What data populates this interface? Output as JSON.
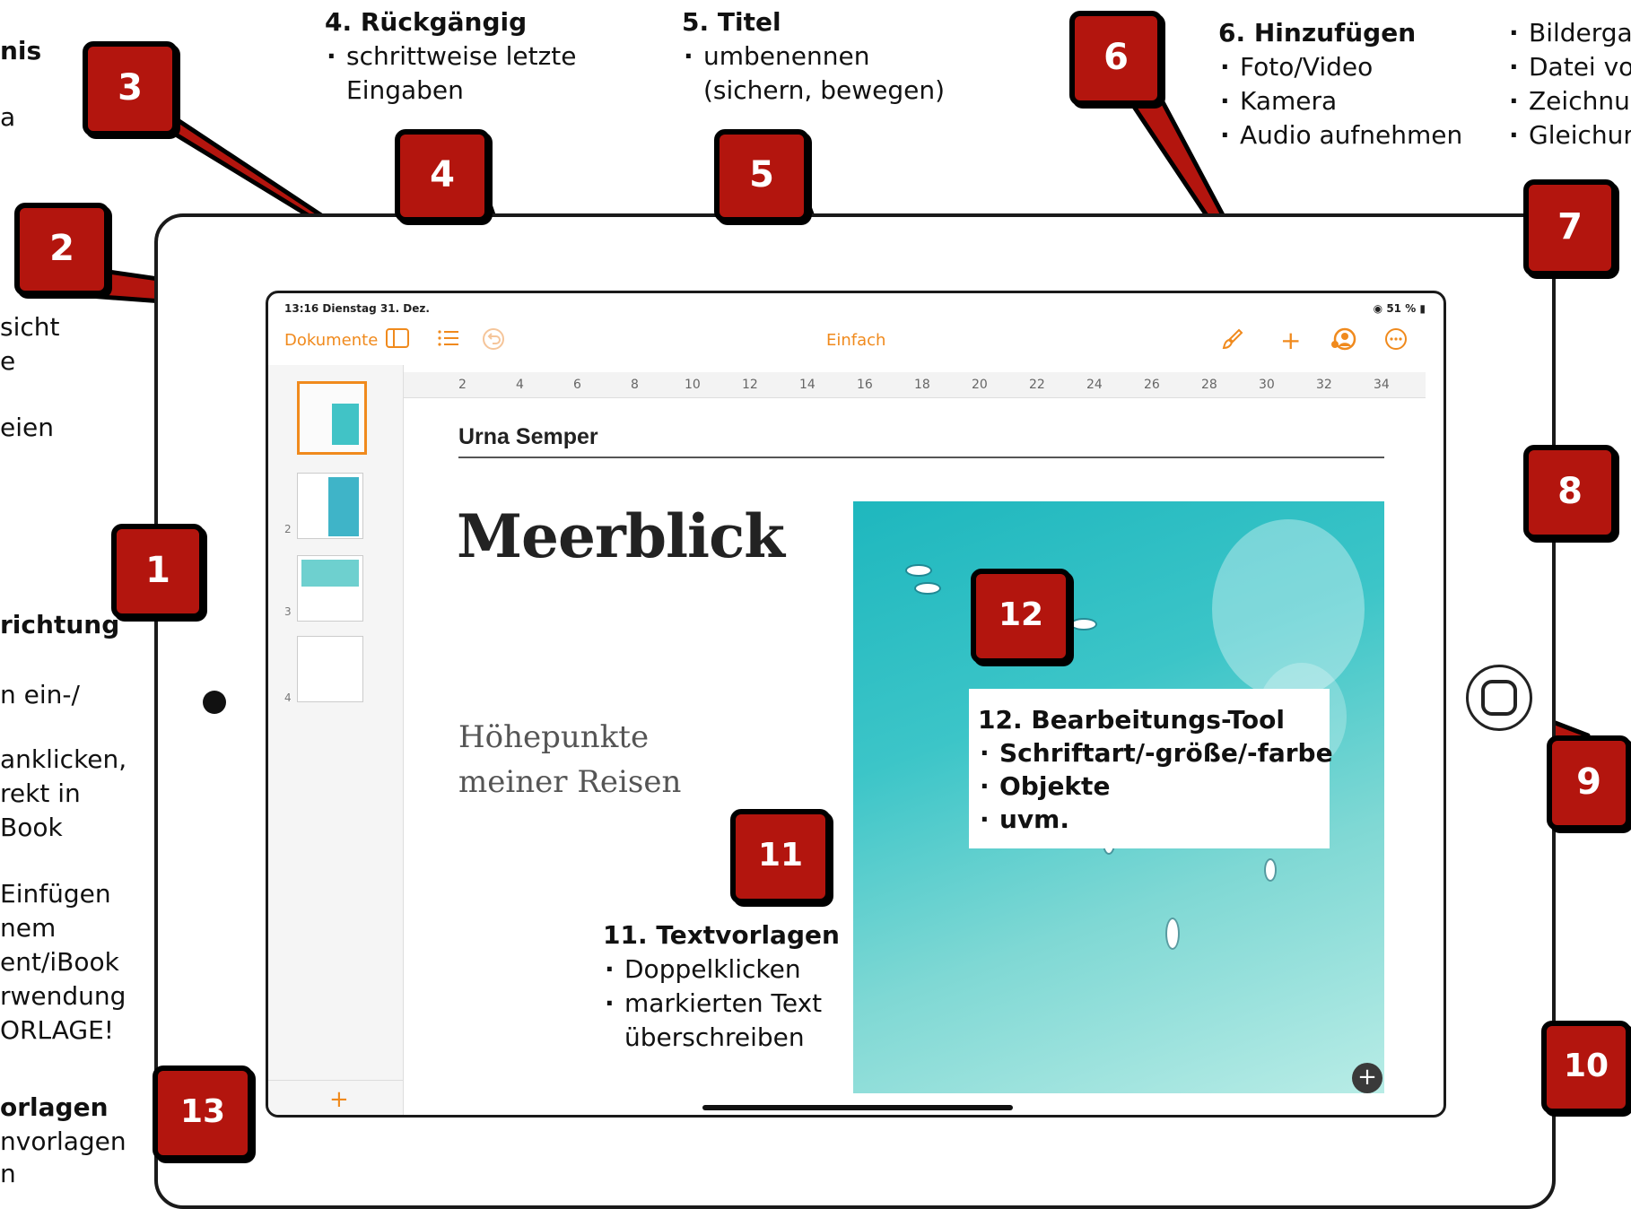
{
  "annotations": {
    "n4": {
      "heading": "4. Rückgängig",
      "items": [
        "schrittweise letzte",
        "Eingaben"
      ]
    },
    "n5": {
      "heading": "5. Titel",
      "items": [
        "umbenennen",
        "(sichern, bewegen)"
      ]
    },
    "n6": {
      "heading": "6. Hinzufügen",
      "items": [
        "Foto/Video",
        "Kamera",
        "Audio aufnehmen"
      ]
    },
    "n6b": {
      "items": [
        "Bilderga",
        "Datei vo",
        "Zeichnu",
        "Gleichur"
      ]
    },
    "n11": {
      "heading": "11. Textvorlagen",
      "items": [
        "Doppelklicken",
        "markierten Text",
        "überschreiben"
      ]
    },
    "n12": {
      "heading": "12. Bearbeitungs-Tool",
      "items": [
        "Schriftart/-größe/-farbe",
        "Objekte",
        "uvm."
      ]
    },
    "left": [
      "nis",
      "a",
      "sicht",
      "e",
      "eien",
      "richtung",
      "n ein-/",
      "anklicken,",
      "rekt in",
      "Book",
      "Einfügen",
      "nem",
      "ent/iBook",
      "rwendung",
      "ORLAGE!",
      "orlagen",
      "nvorlagen",
      "n"
    ]
  },
  "badges": [
    "1",
    "2",
    "3",
    "4",
    "5",
    "6",
    "7",
    "8",
    "9",
    "10",
    "11",
    "12",
    "13"
  ],
  "status": {
    "time": "13:16  Dienstag 31. Dez.",
    "battery": "51 %"
  },
  "toolbar": {
    "documents": "Dokumente",
    "title": "Einfach",
    "plus": "+"
  },
  "ruler": [
    "2",
    "4",
    "6",
    "8",
    "10",
    "12",
    "14",
    "16",
    "18",
    "20",
    "22",
    "24",
    "26",
    "28",
    "30",
    "32",
    "34"
  ],
  "pages": [
    "2",
    "3",
    "4"
  ],
  "page": {
    "author": "Urna Semper",
    "title": "Meerblick",
    "subtitle_1": "Höhepunkte",
    "subtitle_2": "meiner Reisen"
  },
  "sidebar": {
    "add": "+"
  },
  "photo_add": "+",
  "colors": {
    "accent": "#f08a1d",
    "badge": "#b3150e"
  }
}
